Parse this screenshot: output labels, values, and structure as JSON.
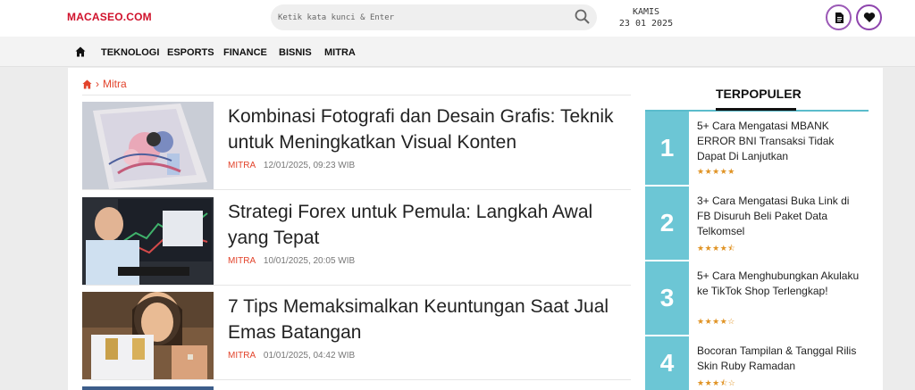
{
  "header": {
    "logo": "MACASEO.COM",
    "search_placeholder": "Ketik kata kunci & Enter",
    "day": "KAMIS",
    "date": "23 01 2025"
  },
  "nav": {
    "items": [
      "TEKNOLOGI",
      "ESPORTS",
      "FINANCE",
      "BISNIS",
      "MITRA"
    ]
  },
  "breadcrumb": {
    "current": "Mitra"
  },
  "articles": [
    {
      "title": "Kombinasi Fotografi dan Desain Grafis: Teknik untuk Meningkatkan Visual Konten",
      "category": "MITRA",
      "datetime": "12/01/2025, 09:23 WIB"
    },
    {
      "title": "Strategi Forex untuk Pemula: Langkah Awal yang Tepat",
      "category": "MITRA",
      "datetime": "10/01/2025, 20:05 WIB"
    },
    {
      "title": "7 Tips Memaksimalkan Keuntungan Saat Jual Emas Batangan",
      "category": "MITRA",
      "datetime": "01/01/2025, 04:42 WIB"
    }
  ],
  "sidebar": {
    "title": "TERPOPULER",
    "items": [
      {
        "num": "1",
        "title": "5+ Cara Mengatasi MBANK ERROR BNI Transaksi Tidak Dapat Di Lanjutkan",
        "stars": "★★★★★",
        "rating": 5
      },
      {
        "num": "2",
        "title": "3+ Cara Mengatasi Buka Link di FB Disuruh Beli Paket Data Telkomsel",
        "stars": "★★★★⯪",
        "rating": 4.5
      },
      {
        "num": "3",
        "title": "5+ Cara Menghubungkan Akulaku ke TikTok Shop Terlengkap!",
        "stars": "★★★★☆",
        "rating": 4
      },
      {
        "num": "4",
        "title": "Bocoran Tampilan & Tanggal Rilis Skin Ruby Ramadan",
        "stars": "★★★⯪☆",
        "rating": 3.5
      }
    ]
  },
  "colors": {
    "accent": "#e2432b",
    "logo": "#d0112b",
    "teal": "#6cc6d5"
  }
}
